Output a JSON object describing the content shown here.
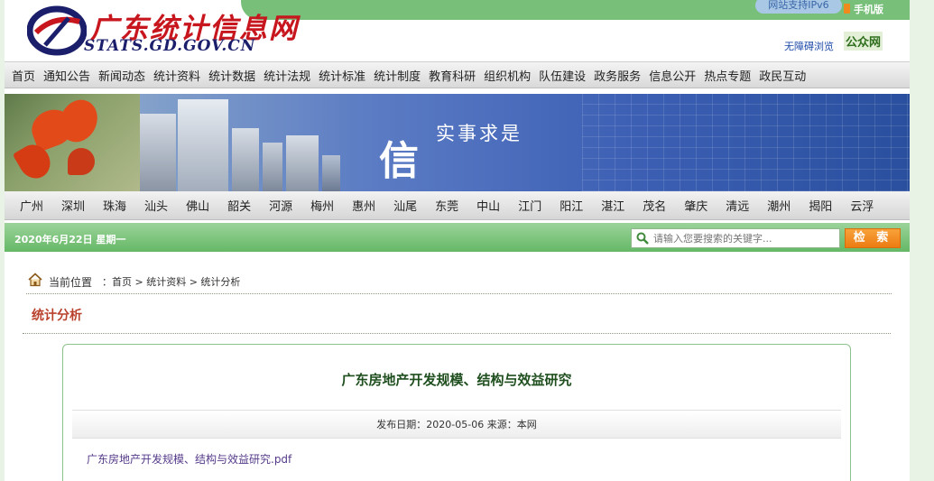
{
  "header": {
    "logo_cn": "广东统计信息网",
    "logo_en": "STATS.GD.GOV.CN",
    "ipv6": "网站支持IPv6",
    "mobile": "手机版",
    "accessibility": "无障碍浏览",
    "gzw": "公众网"
  },
  "main_nav": [
    "首页",
    "通知公告",
    "新闻动态",
    "统计资料",
    "统计数据",
    "统计法规",
    "统计标准",
    "统计制度",
    "教育科研",
    "组织机构",
    "队伍建设",
    "政务服务",
    "信息公开",
    "热点专题",
    "政民互动"
  ],
  "banner": {
    "char": "信",
    "slogan": "实事求是"
  },
  "city_nav": [
    "广州",
    "深圳",
    "珠海",
    "汕头",
    "佛山",
    "韶关",
    "河源",
    "梅州",
    "惠州",
    "汕尾",
    "东莞",
    "中山",
    "江门",
    "阳江",
    "湛江",
    "茂名",
    "肇庆",
    "清远",
    "潮州",
    "揭阳",
    "云浮"
  ],
  "info_bar": {
    "date": "2020年6月22日  星期一",
    "search_placeholder": "请输入您要搜索的关键字...",
    "search_button": "检 索"
  },
  "breadcrumb": {
    "prefix": "当前位置",
    "path": "：首页 > 统计资料 > 统计分析"
  },
  "section_title": "统计分析",
  "article": {
    "title": "广东房地产开发规模、结构与效益研究",
    "meta": "发布日期：2020-05-06    来源：本网",
    "attachment": "广东房地产开发规模、结构与效益研究.pdf"
  },
  "colors": {
    "brand_green": "#65b866",
    "logo_red": "#c8161e",
    "logo_navy": "#1b1f6b",
    "search_orange": "#ec7c12",
    "section_red": "#b9412b"
  }
}
